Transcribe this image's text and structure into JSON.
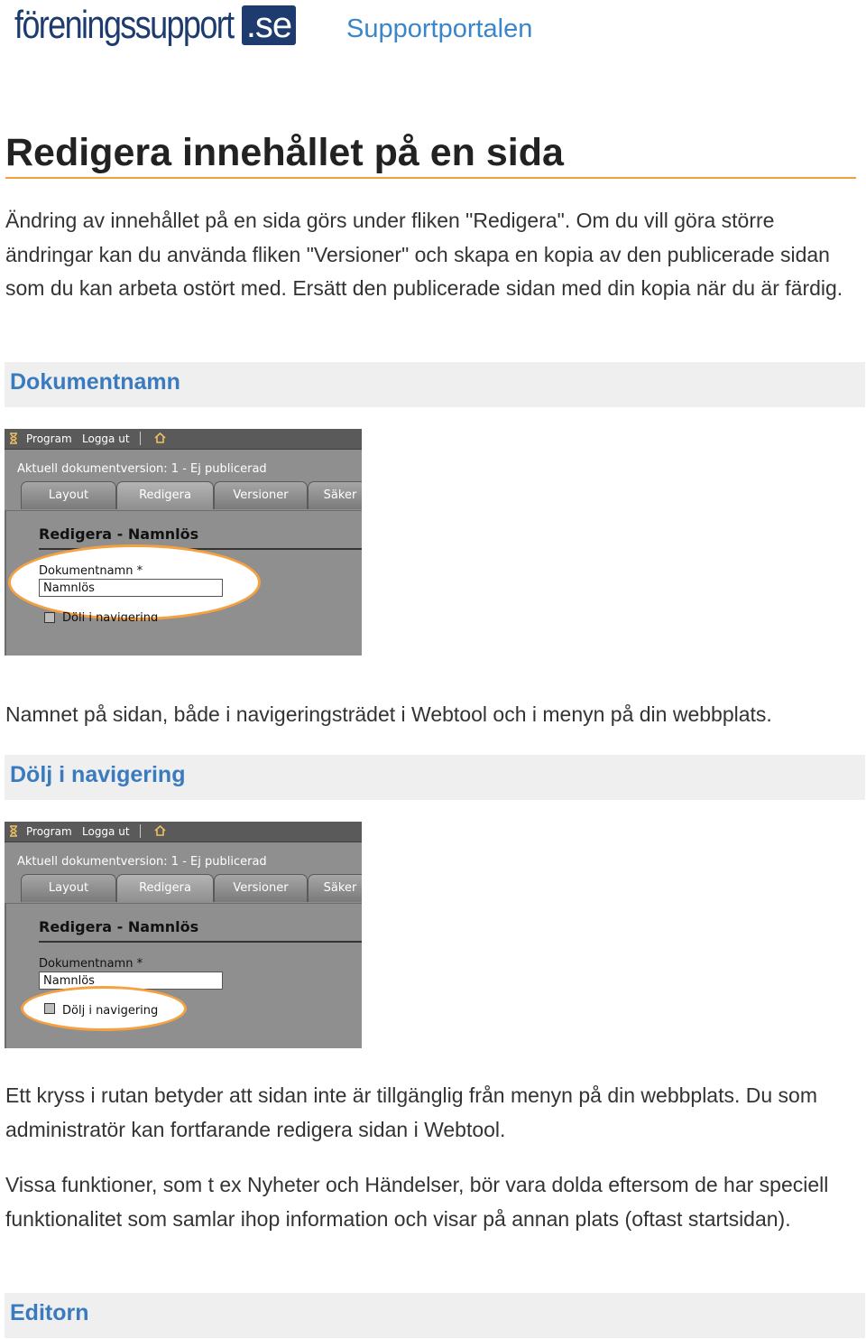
{
  "header": {
    "logo_main": "föreningssupport",
    "logo_tld": ".se",
    "portal_title": "Supportportalen"
  },
  "page": {
    "title": "Redigera innehållet på en sida",
    "intro": "Ändring av innehållet på en sida görs under fliken \"Redigera\". Om du vill göra större ändringar kan du använda fliken \"Versioner\" och skapa en kopia av den publicerade sidan som du kan arbeta ostört med. Ersätt den publicerade sidan med din kopia när du är färdig."
  },
  "sections": [
    {
      "heading": "Dokumentnamn",
      "text": "Namnet på sidan, både i navigeringsträdet i Webtool och i menyn på din webbplats."
    },
    {
      "heading": "Dölj i navigering",
      "text": "Ett kryss i rutan betyder att sidan inte är tillgänglig från menyn på din webbplats. Du som administratör kan fortfarande redigera sidan i Webtool.",
      "text2": "Vissa funktioner, som t ex Nyheter och Händelser, bör vara dolda eftersom de har speciell funktionalitet som samlar ihop information och visar på annan plats (oftast startsidan)."
    },
    {
      "heading": "Editorn"
    }
  ],
  "screenshot": {
    "menu_program": "Program",
    "menu_logout": "Logga ut",
    "status": "Aktuell dokumentversion: 1 - Ej publicerad",
    "tabs": [
      "Layout",
      "Redigera",
      "Versioner",
      "Säker"
    ],
    "panel_title": "Redigera - Namnlös",
    "field_label": "Dokumentnamn *",
    "field_value": "Namnlös",
    "checkbox_label": "Dölj i navigering",
    "icons": [
      "hourglass-icon",
      "home-icon"
    ]
  },
  "colors": {
    "accent_orange": "#f0a03c",
    "link_blue": "#3a7bbf",
    "portal_blue": "#3a86c8",
    "logo_navy": "#1d3b6f",
    "section_bg": "#efefef"
  }
}
